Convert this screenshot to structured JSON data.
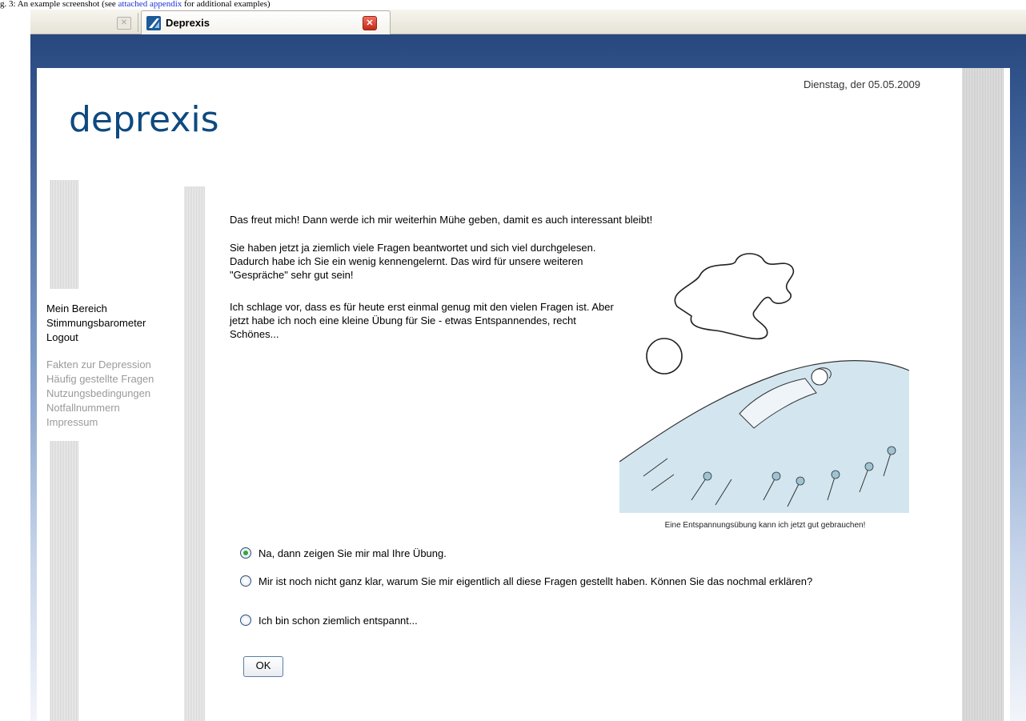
{
  "caption": {
    "prefix": "g. 3: An example screenshot (see ",
    "link": "attached appendix",
    "suffix": " for additional examples)"
  },
  "browser": {
    "tab_title": "Deprexis"
  },
  "header": {
    "logo": "deprexis",
    "date": "Dienstag, der 05.05.2009"
  },
  "nav": {
    "main": [
      "Mein Bereich",
      "Stimmungsbarometer",
      "Logout"
    ],
    "secondary": [
      "Fakten zur Depression",
      "Häufig gestellte Fragen",
      "Nutzungsbedingungen",
      "Notfallnummern",
      "Impressum"
    ]
  },
  "content": {
    "intro": "Das freut mich! Dann werde ich mir weiterhin Mühe geben, damit es auch interessant bleibt!",
    "para1": "Sie haben jetzt ja ziemlich viele Fragen beantwortet und sich viel durchgelesen. Dadurch habe ich Sie ein wenig kennengelernt. Das wird für unsere weiteren \"Gespräche\" sehr gut sein!",
    "para2": "Ich schlage vor, dass es für heute erst einmal genug mit den vielen Fragen ist. Aber jetzt habe ich noch eine kleine Übung für Sie - etwas Entspannendes, recht Schönes...",
    "image_caption": "Eine Entspannungsübung kann ich jetzt gut gebrauchen!"
  },
  "options": [
    {
      "label": "Na, dann zeigen Sie mir mal Ihre Übung.",
      "checked": true
    },
    {
      "label": "Mir ist noch nicht ganz klar, warum Sie mir eigentlich all diese Fragen gestellt haben. Können Sie das nochmal erklären?",
      "checked": false
    },
    {
      "label": "Ich bin schon ziemlich entspannt...",
      "checked": false
    }
  ],
  "ok_label": "OK",
  "colors": {
    "brand_blue": "#0d4a80",
    "nav_secondary": "#9a9a9a",
    "radio_checked": "#32a832"
  }
}
